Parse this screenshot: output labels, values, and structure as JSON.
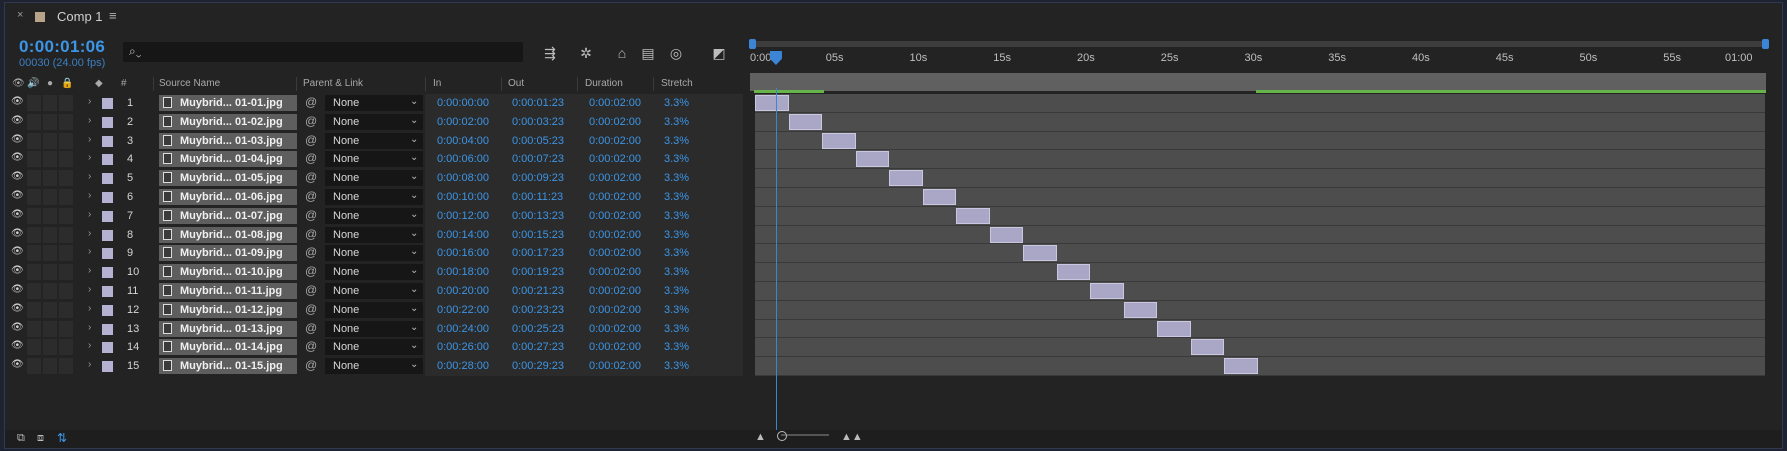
{
  "tab": {
    "close": "×",
    "title": "Comp 1",
    "menu": "≡"
  },
  "time": {
    "current": "0:00:01:06",
    "frame_info": "00030 (24.00 fps)"
  },
  "search": {
    "placeholder": ""
  },
  "columns": {
    "label": "",
    "num": "#",
    "source": "Source Name",
    "parent": "Parent & Link",
    "in": "In",
    "out": "Out",
    "duration": "Duration",
    "stretch": "Stretch"
  },
  "layers": [
    {
      "num": "1",
      "name": "Muybrid... 01-01.jpg",
      "parent": "None",
      "in": "0:00:00:00",
      "out": "0:00:01:23",
      "duration": "0:00:02:00",
      "stretch": "3.3%"
    },
    {
      "num": "2",
      "name": "Muybrid... 01-02.jpg",
      "parent": "None",
      "in": "0:00:02:00",
      "out": "0:00:03:23",
      "duration": "0:00:02:00",
      "stretch": "3.3%"
    },
    {
      "num": "3",
      "name": "Muybrid... 01-03.jpg",
      "parent": "None",
      "in": "0:00:04:00",
      "out": "0:00:05:23",
      "duration": "0:00:02:00",
      "stretch": "3.3%"
    },
    {
      "num": "4",
      "name": "Muybrid... 01-04.jpg",
      "parent": "None",
      "in": "0:00:06:00",
      "out": "0:00:07:23",
      "duration": "0:00:02:00",
      "stretch": "3.3%"
    },
    {
      "num": "5",
      "name": "Muybrid... 01-05.jpg",
      "parent": "None",
      "in": "0:00:08:00",
      "out": "0:00:09:23",
      "duration": "0:00:02:00",
      "stretch": "3.3%"
    },
    {
      "num": "6",
      "name": "Muybrid... 01-06.jpg",
      "parent": "None",
      "in": "0:00:10:00",
      "out": "0:00:11:23",
      "duration": "0:00:02:00",
      "stretch": "3.3%"
    },
    {
      "num": "7",
      "name": "Muybrid... 01-07.jpg",
      "parent": "None",
      "in": "0:00:12:00",
      "out": "0:00:13:23",
      "duration": "0:00:02:00",
      "stretch": "3.3%"
    },
    {
      "num": "8",
      "name": "Muybrid... 01-08.jpg",
      "parent": "None",
      "in": "0:00:14:00",
      "out": "0:00:15:23",
      "duration": "0:00:02:00",
      "stretch": "3.3%"
    },
    {
      "num": "9",
      "name": "Muybrid... 01-09.jpg",
      "parent": "None",
      "in": "0:00:16:00",
      "out": "0:00:17:23",
      "duration": "0:00:02:00",
      "stretch": "3.3%"
    },
    {
      "num": "10",
      "name": "Muybrid... 01-10.jpg",
      "parent": "None",
      "in": "0:00:18:00",
      "out": "0:00:19:23",
      "duration": "0:00:02:00",
      "stretch": "3.3%"
    },
    {
      "num": "11",
      "name": "Muybrid... 01-11.jpg",
      "parent": "None",
      "in": "0:00:20:00",
      "out": "0:00:21:23",
      "duration": "0:00:02:00",
      "stretch": "3.3%"
    },
    {
      "num": "12",
      "name": "Muybrid... 01-12.jpg",
      "parent": "None",
      "in": "0:00:22:00",
      "out": "0:00:23:23",
      "duration": "0:00:02:00",
      "stretch": "3.3%"
    },
    {
      "num": "13",
      "name": "Muybrid... 01-13.jpg",
      "parent": "None",
      "in": "0:00:24:00",
      "out": "0:00:25:23",
      "duration": "0:00:02:00",
      "stretch": "3.3%"
    },
    {
      "num": "14",
      "name": "Muybrid... 01-14.jpg",
      "parent": "None",
      "in": "0:00:26:00",
      "out": "0:00:27:23",
      "duration": "0:00:02:00",
      "stretch": "3.3%"
    },
    {
      "num": "15",
      "name": "Muybrid... 01-15.jpg",
      "parent": "None",
      "in": "0:00:28:00",
      "out": "0:00:29:23",
      "duration": "0:00:02:00",
      "stretch": "3.3%"
    }
  ],
  "ruler": {
    "ticks": [
      "0:00s",
      "05s",
      "10s",
      "15s",
      "20s",
      "25s",
      "30s",
      "35s",
      "40s",
      "45s",
      "50s",
      "55s",
      "01:00"
    ],
    "duration_seconds": 60,
    "current_seconds": 1.25
  },
  "clips_seconds": [
    [
      0,
      2
    ],
    [
      2,
      4
    ],
    [
      4,
      6
    ],
    [
      6,
      8
    ],
    [
      8,
      10
    ],
    [
      10,
      12
    ],
    [
      12,
      14
    ],
    [
      14,
      16
    ],
    [
      16,
      18
    ],
    [
      18,
      20
    ],
    [
      20,
      22
    ],
    [
      22,
      24
    ],
    [
      24,
      26
    ],
    [
      26,
      28
    ],
    [
      28,
      30
    ]
  ],
  "colors": {
    "accent": "#3c95e6",
    "label": "#b5b1d2",
    "work_area": "#67b44a"
  },
  "icons": [
    "search-icon",
    "eye-icon",
    "audio-icon",
    "solo-icon",
    "lock-icon",
    "label-icon",
    "file-icon",
    "pickwhip-icon",
    "chevron-down-icon"
  ]
}
